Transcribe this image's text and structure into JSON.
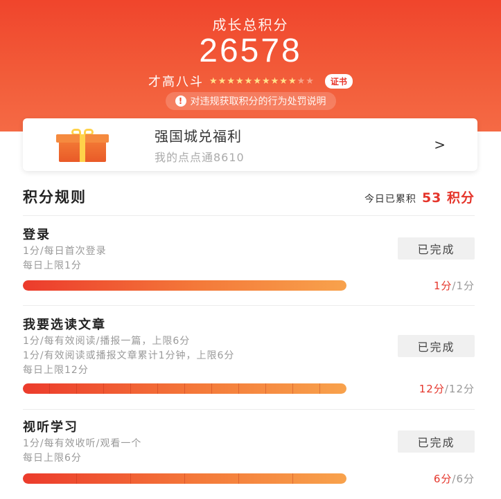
{
  "header": {
    "score_label": "成长总积分",
    "total_score": "26578",
    "rank_title": "才高八斗",
    "stars_filled": 10,
    "stars_total": 12,
    "certificate_label": "证书",
    "notice_text": "对违规获取积分的行为处罚说明"
  },
  "welfare_card": {
    "title": "强国城兑福利",
    "subtitle": "我的点点通8610",
    "chevron": ">"
  },
  "rules": {
    "title": "积分规则",
    "today_label": "今日已累积",
    "today_value": "53 积分",
    "items": [
      {
        "name": "登录",
        "desc": [
          "1分/每日首次登录",
          "每日上限1分"
        ],
        "button": "已完成",
        "progress": 1.0,
        "ticks": 0,
        "got": "1分",
        "max": "1分"
      },
      {
        "name": "我要选读文章",
        "desc": [
          "1分/每有效阅读/播报一篇，上限6分",
          "1分/有效阅读或播报文章累计1分钟，上限6分",
          "每日上限12分"
        ],
        "button": "已完成",
        "progress": 1.0,
        "ticks": 11,
        "got": "12分",
        "max": "12分"
      },
      {
        "name": "视听学习",
        "desc": [
          "1分/每有效收听/观看一个",
          "每日上限6分"
        ],
        "button": "已完成",
        "progress": 1.0,
        "ticks": 5,
        "got": "6分",
        "max": "6分"
      }
    ]
  },
  "colors": {
    "accent": "#e5352b",
    "header_top": "#f0452c",
    "header_bottom": "#f56a45"
  }
}
